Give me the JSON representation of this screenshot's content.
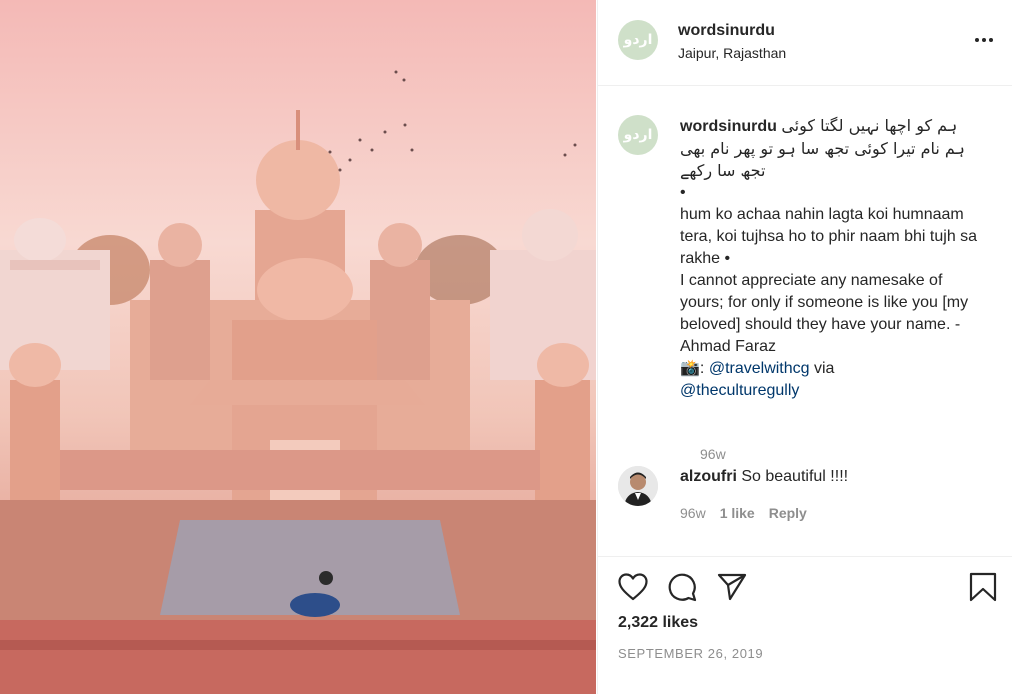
{
  "post": {
    "username": "wordsinurdu",
    "location": "Jaipur, Rajasthan",
    "avatar_text": "اردو",
    "caption": {
      "urdu_lines": [
        "ہم کو اچھا نہیں لگتا کوئی",
        "ہم نام تیرا کوئی تجھ سا ہو تو پھر نام بھی",
        "تجھ سا رکھے"
      ],
      "bullet": "•",
      "roman": "hum ko achaa nahin lagta koi humnaam tera, koi tujhsa ho to phir naam bhi tujh sa rakhe •",
      "english": "I cannot appreciate any namesake of yours; for only if someone is like you [my beloved] should they have your name. -Ahmad Faraz",
      "credit_emoji": "📸:",
      "mention_1": "@travelwithcg",
      "via": "via",
      "mention_2": "@theculturegully",
      "time": "96w"
    },
    "comment": {
      "username": "alzoufri",
      "text": "So beautiful !!!!",
      "time": "96w",
      "likes": "1 like",
      "reply": "Reply"
    },
    "likes": "2,322 likes",
    "date": "SEPTEMBER 26, 2019",
    "icons": {
      "like": "heart-icon",
      "comment": "comment-icon",
      "share": "paper-plane-icon",
      "save": "bookmark-icon",
      "more": "more-options-icon"
    }
  }
}
